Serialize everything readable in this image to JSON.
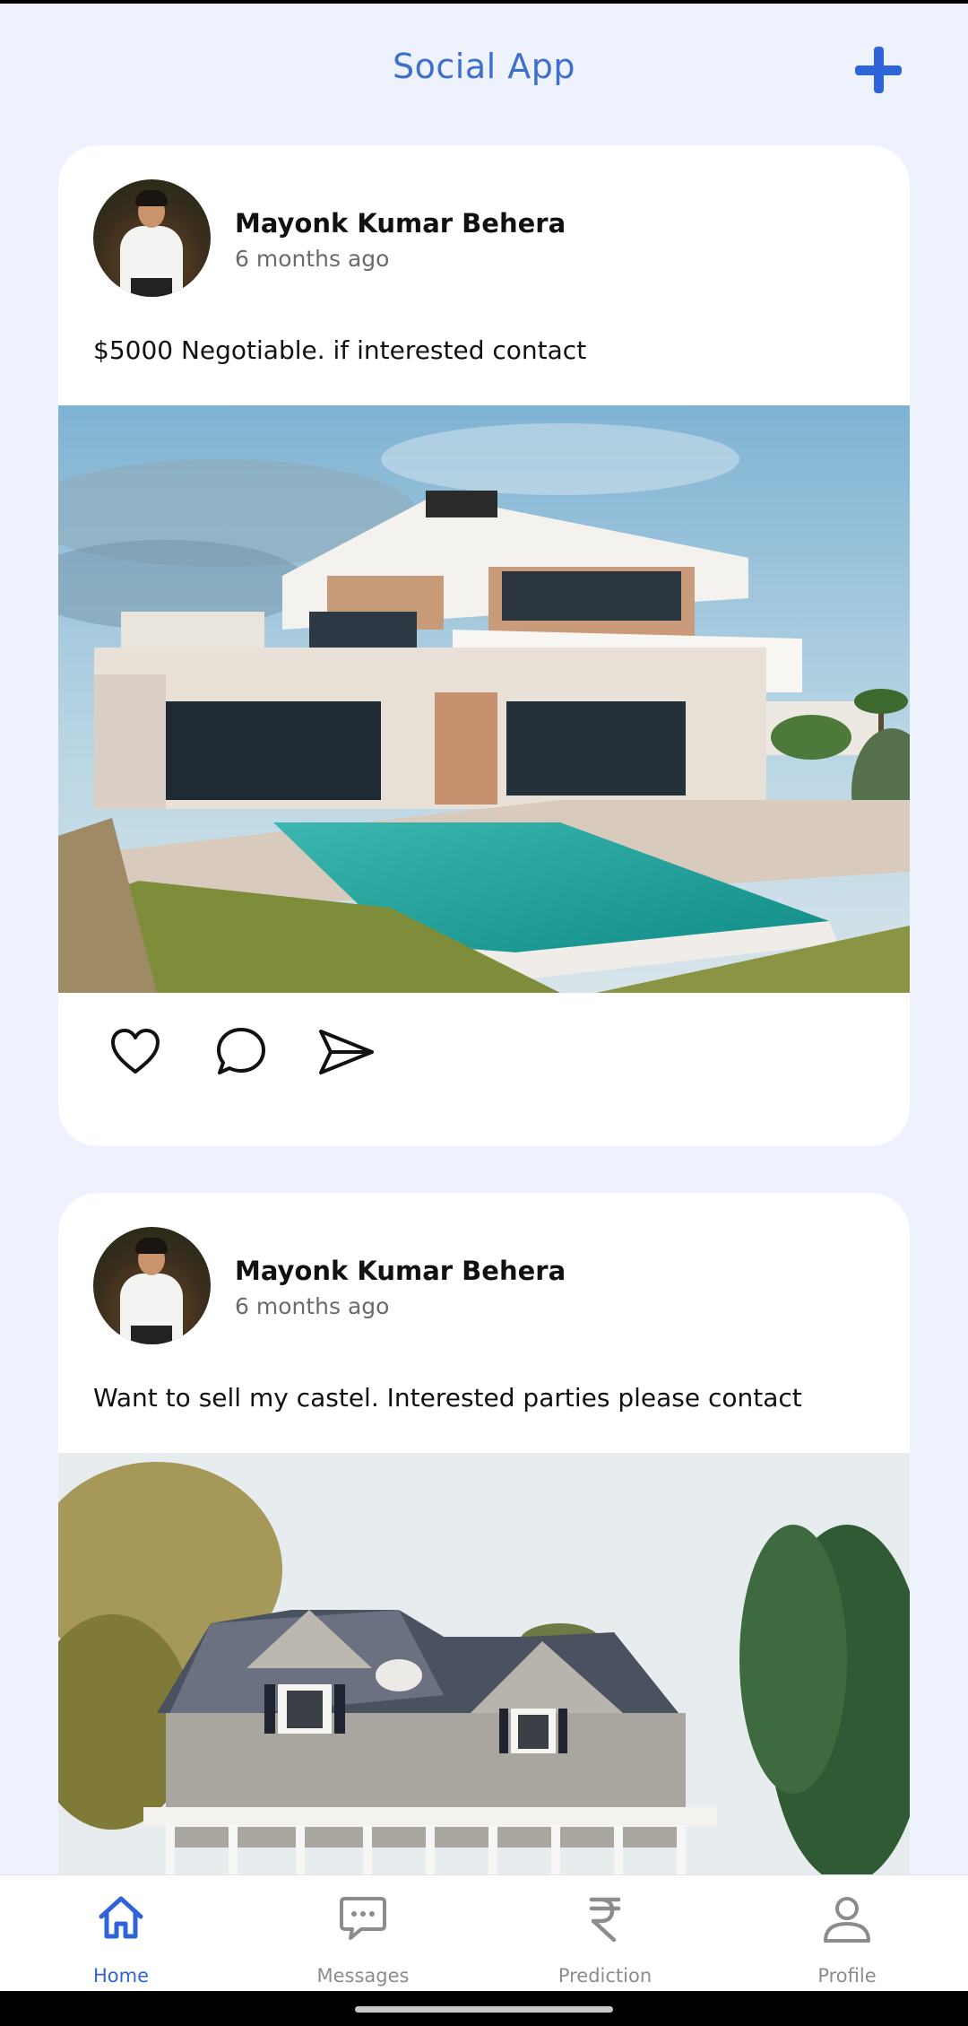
{
  "app": {
    "title": "Social App"
  },
  "header": {
    "add_icon": "plus-icon"
  },
  "posts": [
    {
      "author": "Mayonk Kumar Behera",
      "time": "6 months ago",
      "text": "$5000 Negotiable. if interested contact",
      "image": "modern-villa-with-pool"
    },
    {
      "author": "Mayonk Kumar Behera",
      "time": "6 months ago",
      "text": "Want to sell my castel. Interested parties please contact",
      "image": "grey-shingle-house"
    }
  ],
  "post_actions": [
    "heart-icon",
    "comment-icon",
    "send-icon"
  ],
  "nav": {
    "items": [
      {
        "label": "Home",
        "icon": "home-icon",
        "active": true
      },
      {
        "label": "Messages",
        "icon": "messages-icon",
        "active": false
      },
      {
        "label": "Prediction",
        "icon": "rupee-icon",
        "active": false
      },
      {
        "label": "Profile",
        "icon": "profile-icon",
        "active": false
      }
    ]
  },
  "colors": {
    "accent": "#2f63d8",
    "title": "#3f6fce",
    "background": "#eef2fd",
    "inactive": "#8c8c8c"
  }
}
